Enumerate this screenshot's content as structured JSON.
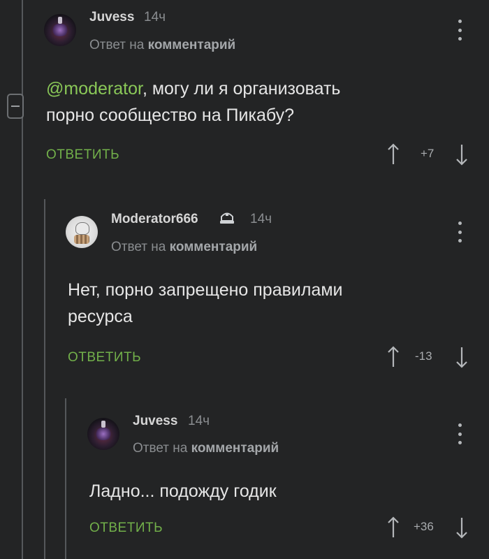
{
  "thread": [
    {
      "username": "Juvess",
      "time": "14ч",
      "reply_prefix": "Ответ на",
      "reply_target": "комментарий",
      "text_mention": "@moderator",
      "text_line1_rest": ", могу ли я организовать",
      "text_line2": "порно сообщество на Пикабу?",
      "reply_label": "ОТВЕТИТЬ",
      "score": "+7",
      "avatar_icon": "dark-eye-avatar-icon"
    },
    {
      "username": "Moderator666",
      "time": "14ч",
      "reply_prefix": "Ответ на",
      "reply_target": "комментарий",
      "text_line1": "Нет, порно запрещено правилами",
      "text_line2": "ресурса",
      "reply_label": "ОТВЕТИТЬ",
      "score": "-13",
      "avatar_icon": "skeleton-avatar-icon",
      "badge_icon": "moderator-badge-icon"
    },
    {
      "username": "Juvess",
      "time": "14ч",
      "reply_prefix": "Ответ на",
      "reply_target": "комментарий",
      "text_line1": "Ладно... подожду годик",
      "reply_label": "ОТВЕТИТЬ",
      "score": "+36",
      "avatar_icon": "dark-eye-avatar-icon"
    }
  ],
  "colors": {
    "background": "#232425",
    "accent_green": "#72b04a",
    "mention_green": "#8ac858",
    "thread_line": "#55585b"
  }
}
